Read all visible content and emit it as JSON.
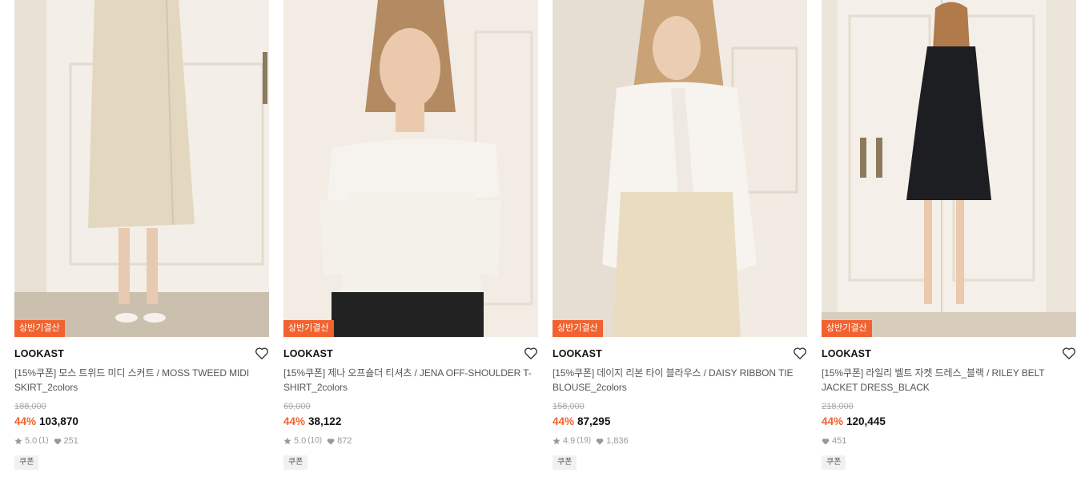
{
  "products": [
    {
      "badge": "상반기결산",
      "brand": "LOOKAST",
      "title": "[15%쿠폰] 모스 트위드 미디 스커트 / MOSS TWEED MIDI SKIRT_2colors",
      "original_price": "188,000",
      "discount": "44%",
      "price": "103,870",
      "rating": "5.0",
      "reviews": "(1)",
      "likes": "251",
      "tag": "쿠폰",
      "image_colors": {
        "bg": "#e9e1d6",
        "door": "#f3eee7",
        "garment": "#e3d7c0",
        "floor": "#cbbfae"
      }
    },
    {
      "badge": "상반기결산",
      "brand": "LOOKAST",
      "title": "[15%쿠폰] 제나 오프숄더 티셔츠 / JENA OFF-SHOULDER T-SHIRT_2colors",
      "original_price": "69,000",
      "discount": "44%",
      "price": "38,122",
      "rating": "5.0",
      "reviews": "(10)",
      "likes": "872",
      "tag": "쿠폰",
      "image_colors": {
        "bg": "#ebe3d9",
        "door": "#f2ece4",
        "garment": "#f6f3ee",
        "floor": "#222222"
      }
    },
    {
      "badge": "상반기결산",
      "brand": "LOOKAST",
      "title": "[15%쿠폰] 데이지 리본 타이 블라우스 / DAISY RIBBON TIE BLOUSE_2colors",
      "original_price": "158,000",
      "discount": "44%",
      "price": "87,295",
      "rating": "4.9",
      "reviews": "(19)",
      "likes": "1,836",
      "tag": "쿠폰",
      "image_colors": {
        "bg": "#e6ded3",
        "door": "#f1ebe3",
        "garment": "#f7f4ef",
        "floor": "#e9dcc0"
      }
    },
    {
      "badge": "상반기결산",
      "brand": "LOOKAST",
      "title": "[15%쿠폰] 라일리 벨트 자켓 드레스_블랙 / RILEY BELT JACKET DRESS_BLACK",
      "original_price": "218,000",
      "discount": "44%",
      "price": "120,445",
      "rating": "",
      "reviews": "",
      "likes": "451",
      "tag": "쿠폰",
      "image_colors": {
        "bg": "#ece5db",
        "door": "#f4efe8",
        "garment": "#1d1e22",
        "floor": "#d8cdbd"
      }
    }
  ]
}
